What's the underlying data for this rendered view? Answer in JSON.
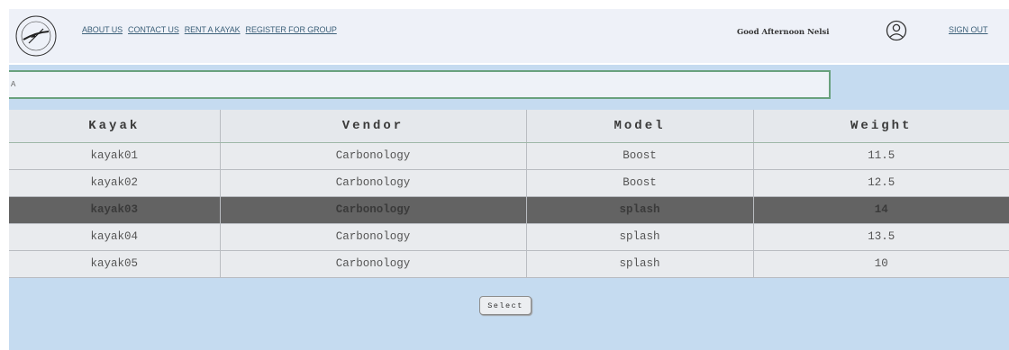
{
  "header": {
    "logo_icon": "kayak-club-logo-icon",
    "nav": [
      {
        "label": "ABOUT US"
      },
      {
        "label": "CONTACT US"
      },
      {
        "label": "RENT A KAYAK"
      },
      {
        "label": "REGISTER FOR GROUP"
      }
    ],
    "greeting": "Good Afternoon Nelsi",
    "user_icon": "user-circle-icon",
    "sign_out": "SIGN OUT"
  },
  "search": {
    "value": "A"
  },
  "table": {
    "columns": [
      "Kayak",
      "Vendor",
      "Model",
      "Weight"
    ],
    "rows": [
      {
        "kayak": "kayak01",
        "vendor": "Carbonology",
        "model": "Boost",
        "weight": "11.5"
      },
      {
        "kayak": "kayak02",
        "vendor": "Carbonology",
        "model": "Boost",
        "weight": "12.5"
      },
      {
        "kayak": "kayak03",
        "vendor": "Carbonology",
        "model": "splash",
        "weight": "14"
      },
      {
        "kayak": "kayak04",
        "vendor": "Carbonology",
        "model": "splash",
        "weight": "13.5"
      },
      {
        "kayak": "kayak05",
        "vendor": "Carbonology",
        "model": "splash",
        "weight": "10"
      }
    ],
    "selected_row": 2
  },
  "actions": {
    "select_label": "Select"
  },
  "colors": {
    "content_bg": "#c5dbf0",
    "selected_row": "#636363",
    "link": "#3c6079",
    "search_border": "#69a17e"
  }
}
